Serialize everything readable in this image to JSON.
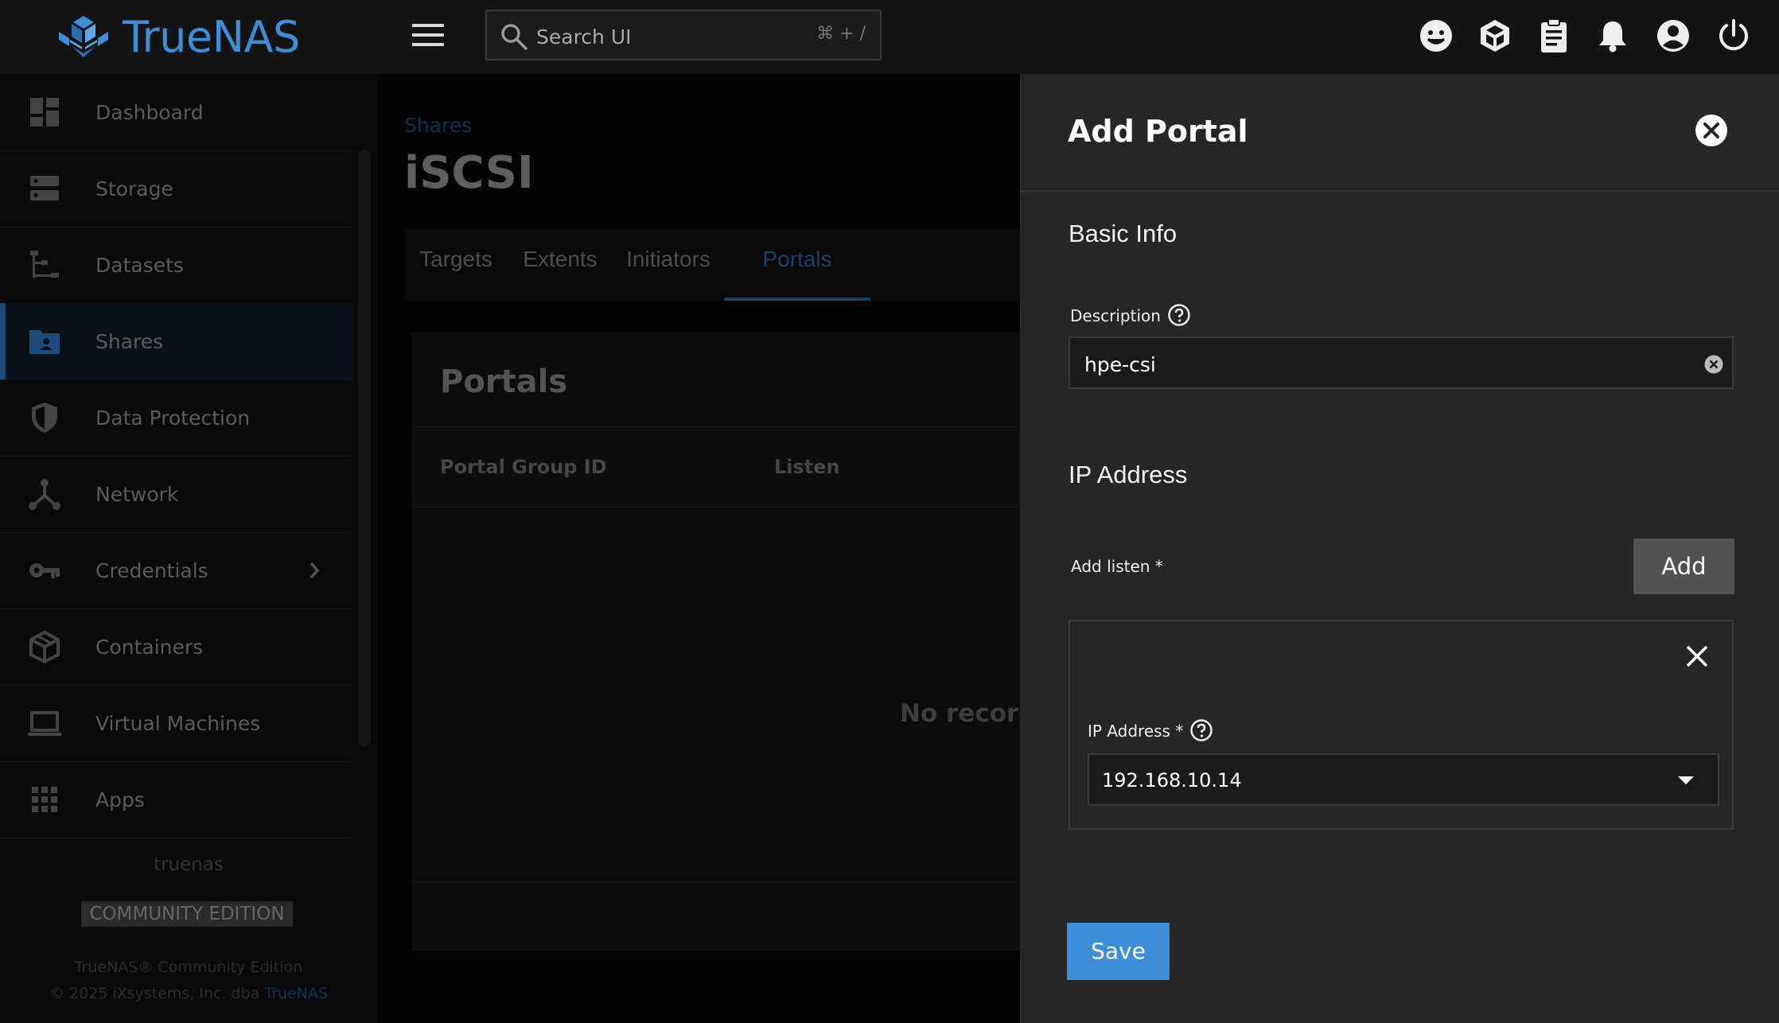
{
  "app": {
    "brand": "TrueNAS",
    "search": {
      "placeholder": "Search UI",
      "shortcut": "⌘ + /"
    },
    "top_icons": [
      "feedback-icon",
      "truecommand-icon",
      "jobs-icon",
      "notifications-icon",
      "account-icon",
      "power-icon"
    ]
  },
  "sidebar": {
    "items": [
      {
        "label": "Dashboard",
        "icon": "dashboard-icon"
      },
      {
        "label": "Storage",
        "icon": "storage-icon"
      },
      {
        "label": "Datasets",
        "icon": "datasets-icon"
      },
      {
        "label": "Shares",
        "icon": "shares-icon",
        "active": true
      },
      {
        "label": "Data Protection",
        "icon": "shield-icon"
      },
      {
        "label": "Network",
        "icon": "network-icon"
      },
      {
        "label": "Credentials",
        "icon": "key-icon",
        "has_submenu": true
      },
      {
        "label": "Containers",
        "icon": "cube-icon"
      },
      {
        "label": "Virtual Machines",
        "icon": "laptop-icon"
      },
      {
        "label": "Apps",
        "icon": "apps-grid-icon"
      }
    ],
    "hostname": "truenas",
    "edition": "COMMUNITY EDITION",
    "copyright_line1": "TrueNAS® Community Edition",
    "copyright_line2": "© 2025 iXsystems, Inc. dba",
    "copyright_link": "TrueNAS"
  },
  "main": {
    "breadcrumb": "Shares",
    "title": "iSCSI",
    "tabs": [
      {
        "label": "Targets"
      },
      {
        "label": "Extents"
      },
      {
        "label": "Initiators"
      },
      {
        "label": "Portals",
        "active": true
      }
    ],
    "card": {
      "title": "Portals",
      "columns": [
        "Portal Group ID",
        "Listen"
      ],
      "empty_message": "No records"
    }
  },
  "panel": {
    "title": "Add Portal",
    "basic_info": {
      "title": "Basic Info",
      "description_label": "Description",
      "description_value": "hpe-csi"
    },
    "ip_section": {
      "title": "IP Address",
      "add_listen_label": "Add listen *",
      "add_button": "Add",
      "listen": {
        "ip_label": "IP Address *",
        "ip_value": "192.168.10.14"
      }
    },
    "save_button": "Save"
  },
  "colors": {
    "accent": "#3d8ed8",
    "panel_bg": "#262626",
    "topbar_bg": "#141414"
  }
}
